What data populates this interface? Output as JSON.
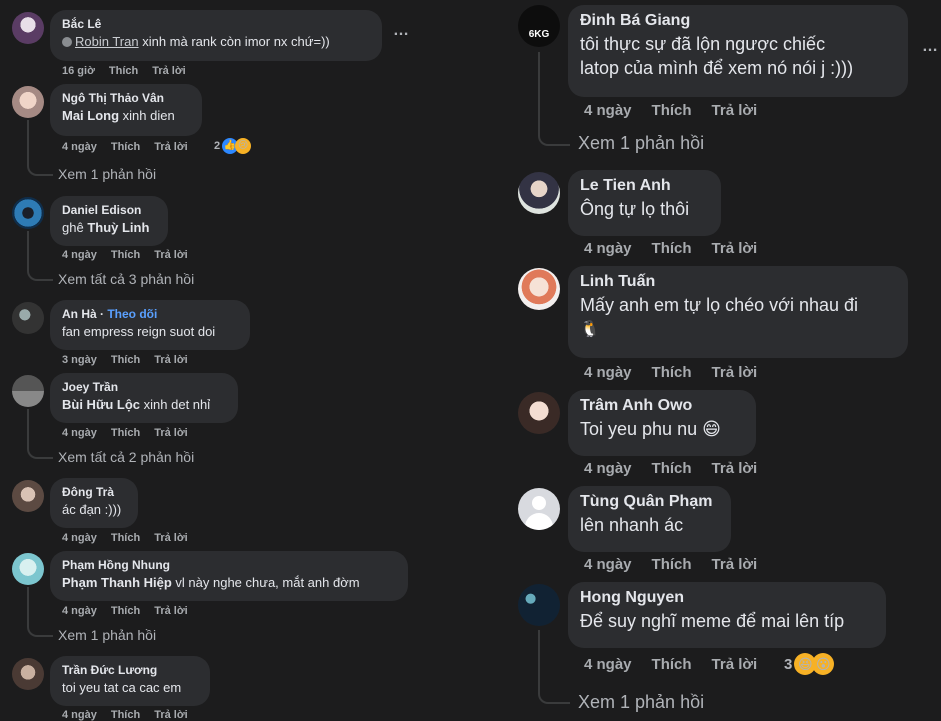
{
  "left": [
    {
      "name": "Bắc Lê",
      "mention": "Robin Tran",
      "text": " xinh mà rank còn imor nx chứ=))",
      "time": "16 giờ",
      "like": "Thích",
      "reply": "Trả lời"
    },
    {
      "name": "Ngô Thị Thảo Vân",
      "mention": "Mai Long",
      "text": " xinh dien",
      "time": "4 ngày",
      "like": "Thích",
      "reply": "Trả lời",
      "react_count": "2",
      "more": "Xem 1 phản hồi"
    },
    {
      "name": "Daniel Edison",
      "mention": "",
      "text": "ghê ",
      "mention2": "Thuỳ Linh",
      "time": "4 ngày",
      "like": "Thích",
      "reply": "Trả lời",
      "more": "Xem tất cả 3 phản hồi"
    },
    {
      "name": "An Hà",
      "follow": "Theo dõi",
      "text": "fan empress reign suot doi",
      "time": "3 ngày",
      "like": "Thích",
      "reply": "Trả lời"
    },
    {
      "name": "Joey Trần",
      "mention": "Bùi Hữu Lộc",
      "text": " xinh det nhỉ",
      "time": "4 ngày",
      "like": "Thích",
      "reply": "Trả lời",
      "more": "Xem tất cả 2 phản hồi"
    },
    {
      "name": "Đông Trà",
      "text": "ác đạn :)))",
      "time": "4 ngày",
      "like": "Thích",
      "reply": "Trả lời"
    },
    {
      "name": "Phạm Hồng Nhung",
      "mention": "Phạm Thanh Hiệp",
      "text": " vl này nghe chưa, mắt anh đờm",
      "time": "4 ngày",
      "like": "Thích",
      "reply": "Trả lời",
      "more": "Xem 1 phản hồi"
    },
    {
      "name": "Trần Đức Lương",
      "text": "toi yeu tat ca cac em",
      "time": "4 ngày",
      "like": "Thích",
      "reply": "Trả lời"
    }
  ],
  "right": [
    {
      "name": "Đinh Bá Giang",
      "text": "tôi thực sự đã lộn ngược chiếc",
      "text2": "latop của mình để xem nó nói j :)))",
      "time": "4 ngày",
      "like": "Thích",
      "reply": "Trả lời",
      "more": "Xem 1 phản hồi",
      "avatar_label": "6KG"
    },
    {
      "name": "Le Tien Anh",
      "text": "Ông tự lọ thôi",
      "time": "4 ngày",
      "like": "Thích",
      "reply": "Trả lời"
    },
    {
      "name": "Linh Tuấn",
      "text": "Mấy anh em tự lọ chéo với nhau đi",
      "text2": "🐧",
      "time": "4 ngày",
      "like": "Thích",
      "reply": "Trả lời"
    },
    {
      "name": "Trâm Anh Owo",
      "text": "Toi yeu phu nu 😄",
      "time": "4 ngày",
      "like": "Thích",
      "reply": "Trả lời"
    },
    {
      "name": "Tùng Quân Phạm",
      "text": "lên nhanh ác",
      "time": "4 ngày",
      "like": "Thích",
      "reply": "Trả lời"
    },
    {
      "name": "Hong Nguyen",
      "text": "Để suy nghĩ meme để mai lên típ",
      "time": "4 ngày",
      "like": "Thích",
      "reply": "Trả lời",
      "react_count": "3",
      "more": "Xem 1 phản hồi"
    }
  ],
  "ellipsis": "…",
  "colors": {
    "bg": "#1c1c1d",
    "bubble": "#2c2d30",
    "link": "#5aa0ff"
  }
}
